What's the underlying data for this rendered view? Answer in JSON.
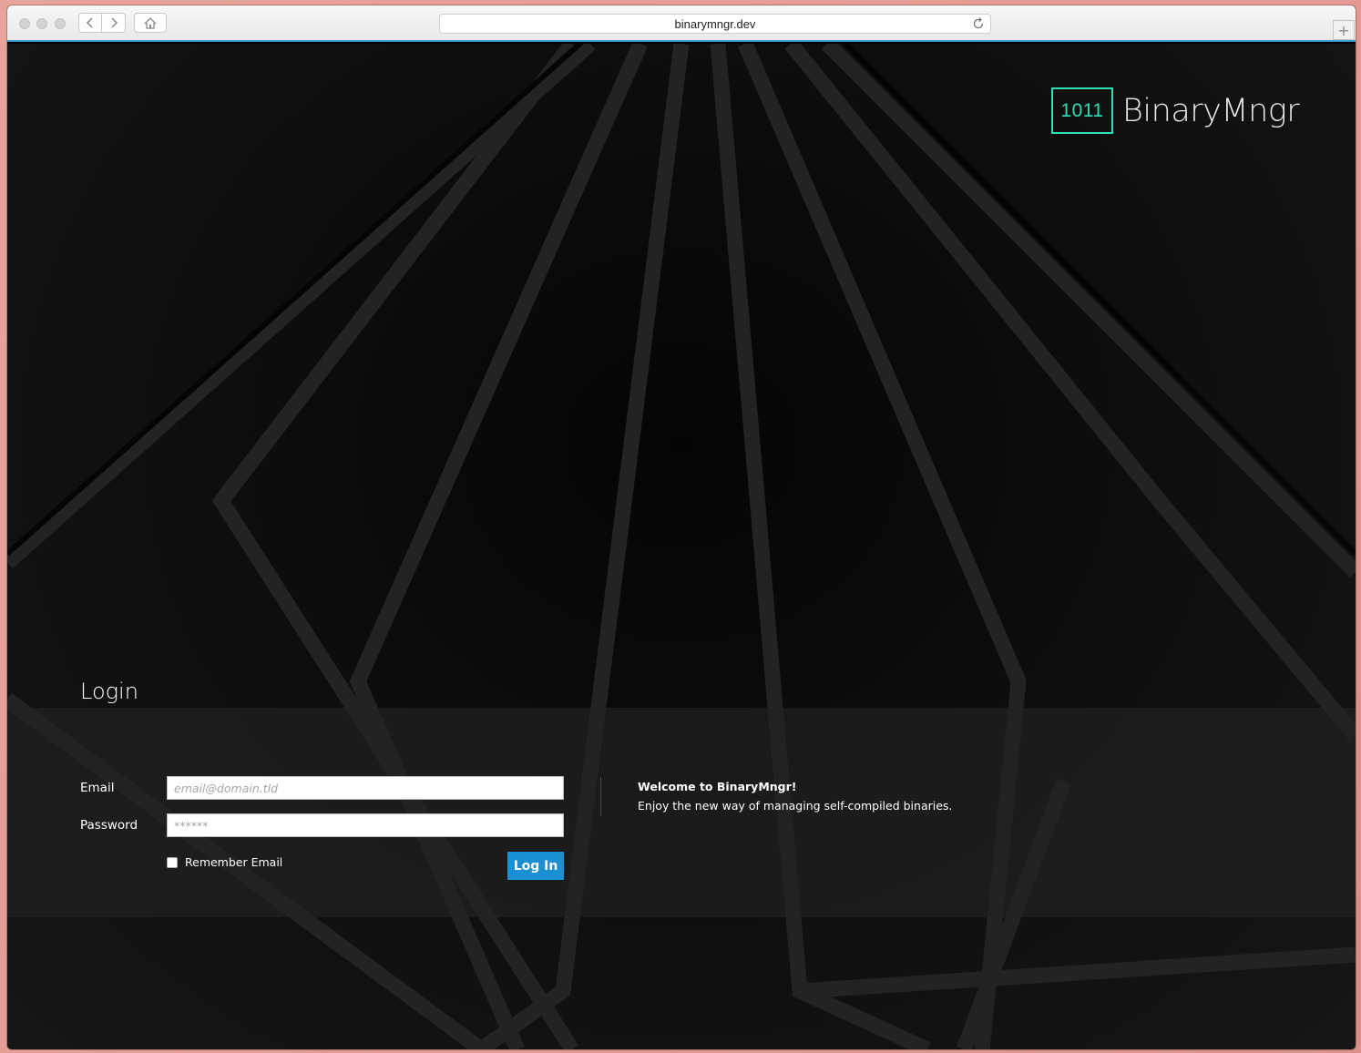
{
  "browser": {
    "url": "binarymngr.dev",
    "back_icon": "chevron-left-icon",
    "forward_icon": "chevron-right-icon",
    "home_icon": "home-icon",
    "reload_icon": "reload-icon",
    "new_tab_label": "+"
  },
  "brand": {
    "logo_mark": "1011",
    "name": "BinaryMngr",
    "accent_color": "#2de0b6"
  },
  "login": {
    "title": "Login",
    "email_label": "Email",
    "email_placeholder": "email@domain.tld",
    "password_label": "Password",
    "password_placeholder": "******",
    "remember_label": "Remember Email",
    "remember_checked": false,
    "submit_label": "Log In",
    "button_color": "#1a8fd1"
  },
  "welcome": {
    "title": "Welcome to BinaryMngr!",
    "text": "Enjoy the new way of managing self-compiled binaries."
  }
}
